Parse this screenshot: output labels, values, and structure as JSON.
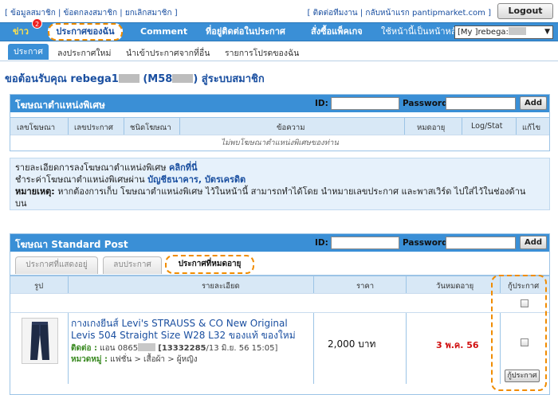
{
  "top": {
    "links_left": [
      "ข้อมูลสมาชิก",
      "ข้อตกลงสมาชิก",
      "ยกเลิกสมาชิก"
    ],
    "links_right": [
      "ติดต่อทีมงาน",
      "กลับหน้าแรก pantipmarket.com"
    ],
    "logout": "Logout"
  },
  "nav": {
    "news": "ข่าว",
    "news_count": "2",
    "mine": "ประกาศของฉัน",
    "comment": "Comment",
    "follow": "ที่อยู่ติดต่อในประกาศ",
    "order": "สั่งซื้อแพ็คเกจ",
    "homepage_label": "ใช้หน้านี้เป็นหน้าหลัก :",
    "homepage_value": "[My ]rebega:"
  },
  "subnav": {
    "active": "ประกาศ",
    "items": [
      "ลงประกาศใหม่",
      "นำเข้าประกาศจากที่อื่น",
      "รายการโปรดของฉัน"
    ]
  },
  "welcome": {
    "prefix": "ขอต้อนรับคุณ rebega1",
    "middle": " (M58",
    "suffix": ") สู่ระบบสมาชิก"
  },
  "special": {
    "title": "โฆษณาตำแหน่งพิเศษ",
    "id_label": "ID:",
    "password_label": "Password:",
    "add": "Add",
    "columns": [
      "เลขโฆษณา",
      "เลขประกาศ",
      "ชนิดโฆษณา",
      "ข้อความ",
      "หมดอายุ",
      "Log/Stat",
      "แก้ไข"
    ],
    "empty": "ไม่พบโฆษณาตำแหน่งพิเศษของท่าน"
  },
  "info": {
    "line1": "รายละเอียดการลงโฆษณาตำแหน่งพิเศษ",
    "line1_link": "คลิกที่นี่",
    "line2": "ชำระค่าโฆษณาตำแหน่งพิเศษผ่าน",
    "line2_link": "บัญชีธนาคาร, บัตรเครดิต",
    "note_label": "หมายเหตุ:",
    "note": "หากต้องการเก็บ โฆษณาตำแหน่งพิเศษ ไว้ในหน้านี้ สามารถทำได้โดย นำหมายเลขประกาศ และพาสเวิร์ด ไปใส่ไว้ในช่องด้าน",
    "note2": "บน"
  },
  "standard": {
    "title": "โฆษณา Standard Post",
    "id_label": "ID:",
    "password_label": "Password:",
    "add": "Add",
    "tabs": [
      "ประกาศที่แสดงอยู่",
      "ลบประกาศ",
      "ประกาศที่หมดอายุ"
    ],
    "columns": [
      "รูป",
      "รายละเอียด",
      "ราคา",
      "วันหมดอายุ",
      "กู้ประกาศ"
    ],
    "item": {
      "title": "กางเกงยีนส์ Levi's STRAUSS & CO New Original Levis 504 Straight Size W28 L32 ของแท้ ของใหม่",
      "contact_label": "ติดต่อ :",
      "contact": "แอน 0865",
      "post_id": "[13332285",
      "post_date": "/13 มิ.ย. 56 15:05]",
      "category_label": "หมวดหมู่ :",
      "category": "แฟชั่น > เสื้อผ้า > ผู้หญิง",
      "price": "2,000 บาท",
      "expire": "3 พ.ค. 56"
    },
    "renew_button": "กู้ประกาศ"
  }
}
